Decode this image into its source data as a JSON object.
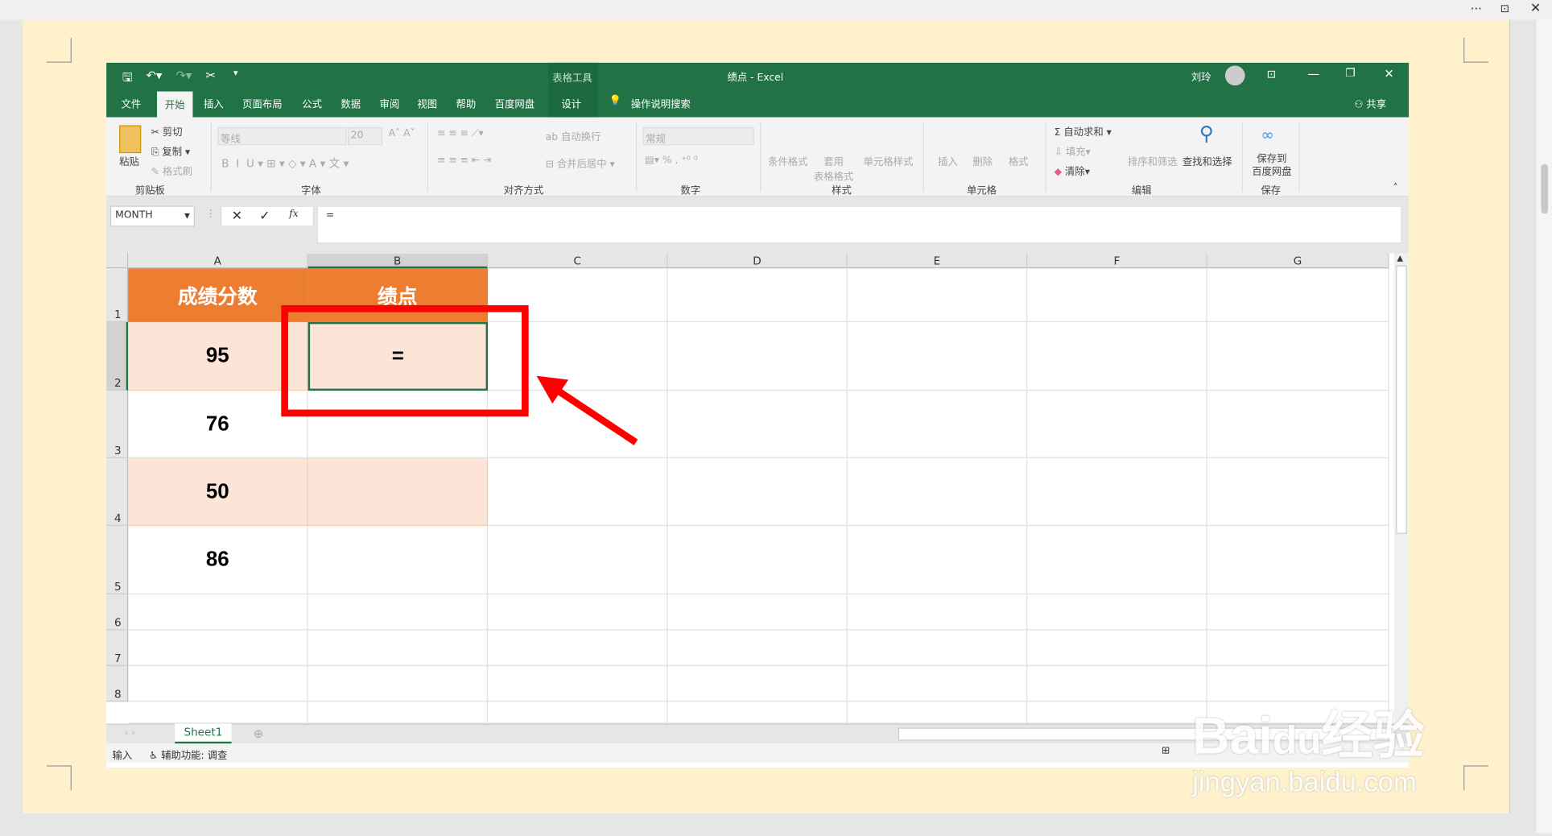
{
  "window": {
    "title": "绩点  -  Excel",
    "context_tab": "表格工具",
    "user": "刘玲",
    "share": "共享"
  },
  "tabs": [
    "文件",
    "开始",
    "插入",
    "页面布局",
    "公式",
    "数据",
    "审阅",
    "视图",
    "帮助",
    "百度网盘",
    "设计"
  ],
  "tell_me": "操作说明搜索",
  "ribbon": {
    "clipboard": {
      "paste": "粘贴",
      "cut": "剪切",
      "copy": "复制",
      "format_painter": "格式刷",
      "group": "剪贴板"
    },
    "font": {
      "name": "等线",
      "size": "20",
      "group": "字体"
    },
    "alignment": {
      "wrap": "自动换行",
      "merge": "合并后居中",
      "group": "对齐方式"
    },
    "number": {
      "format": "常规",
      "group": "数字"
    },
    "styles": {
      "conditional": "条件格式",
      "table": "套用\n表格格式",
      "cell_styles": "单元格样式",
      "group": "样式"
    },
    "cells": {
      "insert": "插入",
      "delete": "删除",
      "format": "格式",
      "group": "单元格"
    },
    "editing": {
      "autosum": "自动求和",
      "fill": "填充",
      "clear": "清除",
      "sort": "排序和筛选",
      "find": "查找和选择",
      "group": "编辑"
    },
    "save": {
      "label": "保存到\n百度网盘",
      "group": "保存"
    }
  },
  "formula_bar": {
    "name_box": "MONTH",
    "value": "="
  },
  "columns": [
    "A",
    "B",
    "C",
    "D",
    "E",
    "F",
    "G"
  ],
  "rows": [
    "1",
    "2",
    "3",
    "4",
    "5",
    "6",
    "7",
    "8"
  ],
  "table": {
    "headers": [
      "成绩分数",
      "绩点"
    ],
    "values": [
      "95",
      "76",
      "50",
      "86"
    ],
    "active_cell_value": "="
  },
  "sheet_tab": "Sheet1",
  "status": {
    "mode": "输入",
    "accessibility": "辅助功能: 调查"
  },
  "watermark": {
    "logo": "Baidu经验",
    "url": "jingyan.baidu.com"
  },
  "colors": {
    "excel_green": "#217346",
    "header_orange": "#ed7d31",
    "band": "#fce4d6",
    "annotation_red": "#ff0000"
  }
}
